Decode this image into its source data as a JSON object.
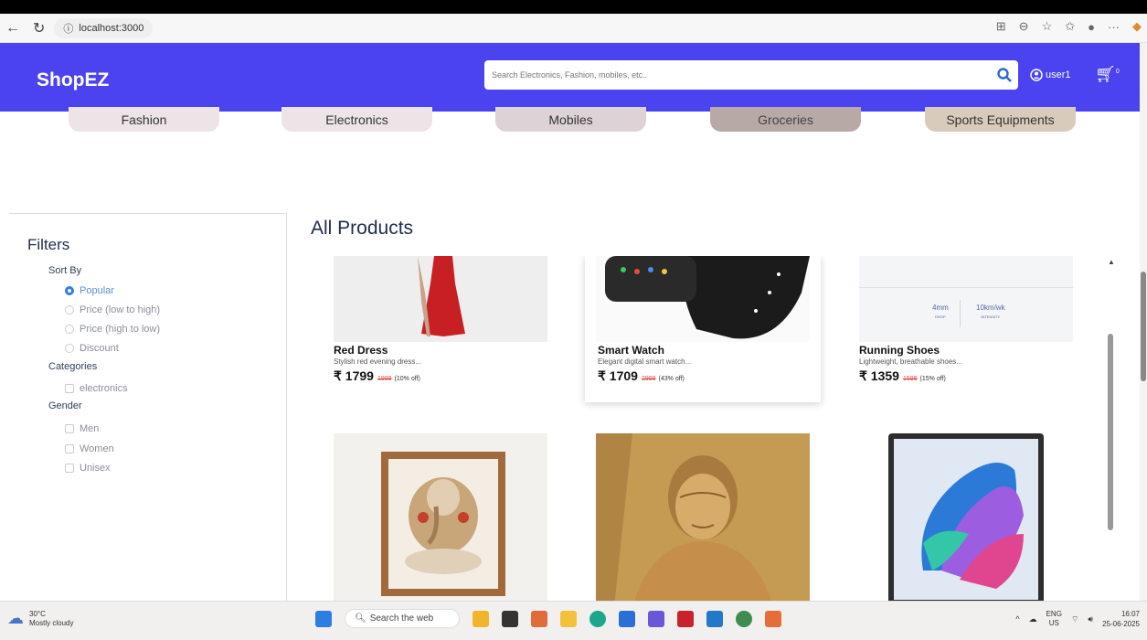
{
  "browser": {
    "url": "localhost:3000"
  },
  "header": {
    "brand": "ShopEZ",
    "search_placeholder": "Search Electronics, Fashion, mobiles, etc..",
    "user_label": "user1",
    "cart_count": "0"
  },
  "categories": [
    "Fashion",
    "Electronics",
    "Mobiles",
    "Groceries",
    "Sports Equipments"
  ],
  "filters": {
    "title": "Filters",
    "sort_by_label": "Sort By",
    "sort_options": [
      "Popular",
      "Price (low to high)",
      "Price (high to low)",
      "Discount"
    ],
    "selected_sort": "Popular",
    "categories_label": "Categories",
    "category_options": [
      "electronics"
    ],
    "gender_label": "Gender",
    "gender_options": [
      "Men",
      "Women",
      "Unisex"
    ]
  },
  "products_title": "All Products",
  "products": [
    {
      "name": "Red Dress",
      "desc": "Stylish red evening dress...",
      "price": "₹ 1799",
      "mrp": "1999",
      "off": "(10% off)"
    },
    {
      "name": "Smart Watch",
      "desc": "Elegant digital smart watch...",
      "price": "₹ 1709",
      "mrp": "2999",
      "off": "(43% off)"
    },
    {
      "name": "Running Shoes",
      "desc": "Lightweight, breathable shoes...",
      "price": "₹ 1359",
      "mrp": "1599",
      "off": "(15% off)",
      "image_stats": [
        {
          "value": "4mm",
          "label": "DROP"
        },
        {
          "value": "10km/wk",
          "label": "INTENSITY"
        }
      ]
    }
  ],
  "taskbar": {
    "temp": "30°C",
    "weather": "Mostly cloudy",
    "search": "Search the web",
    "lang1": "ENG",
    "lang2": "US",
    "time": "16:07",
    "date": "25-06-2025"
  }
}
